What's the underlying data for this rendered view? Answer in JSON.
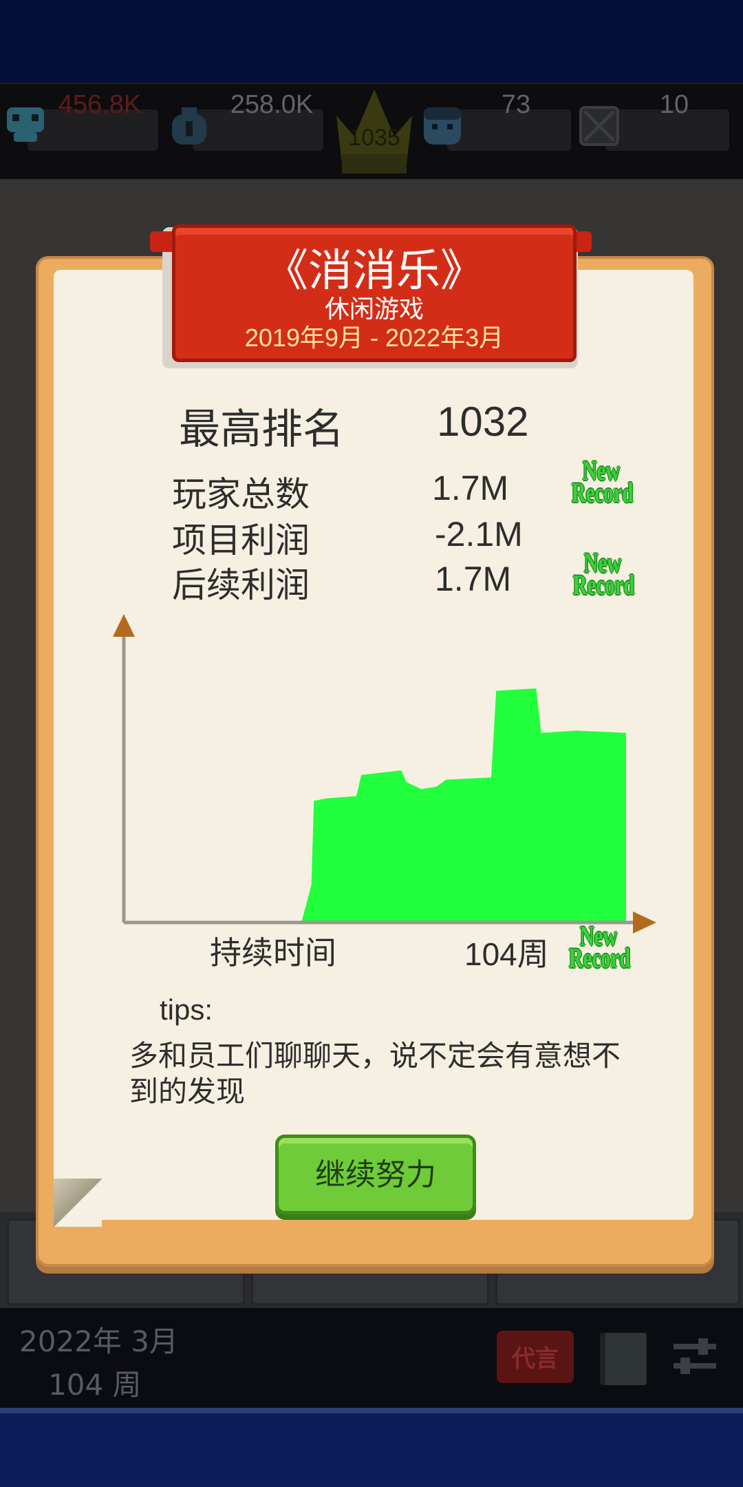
{
  "stats_bar": {
    "money": "456.8K",
    "fans": "258.0K",
    "rank": "1035",
    "employees": "73",
    "extra": "10"
  },
  "modal": {
    "game_title": "《消消乐》",
    "game_genre": "休闲游戏",
    "game_period": "2019年9月 - 2022年3月",
    "best_rank_label": "最高排名",
    "best_rank_value": "1032",
    "rows": [
      {
        "label": "玩家总数",
        "value": "1.7M",
        "new_record": true
      },
      {
        "label": "项目利润",
        "value": "-2.1M",
        "new_record": false
      },
      {
        "label": "后续利润",
        "value": "1.7M",
        "new_record": true
      }
    ],
    "new_record_text": "New Record",
    "duration_label": "持续时间",
    "duration_value": "104周",
    "duration_new_record": true,
    "tips_title": "tips:",
    "tips_text": "多和员工们聊聊天，说不定会有意想不到的发现",
    "continue_label": "继续努力"
  },
  "chart_data": {
    "type": "area",
    "series": [
      {
        "values": [
          0,
          0,
          0,
          0,
          0,
          0,
          0,
          0,
          0,
          0,
          0,
          0,
          0,
          0,
          0,
          0,
          0,
          0,
          0,
          0,
          0,
          0,
          0,
          0,
          0,
          0,
          0,
          0,
          0,
          0,
          0,
          0,
          0,
          0,
          0,
          0,
          0,
          0,
          0,
          0,
          0,
          0,
          0,
          0,
          0,
          0,
          0,
          0,
          0,
          0,
          0,
          0,
          0,
          0,
          0,
          0,
          0,
          0,
          0,
          0,
          0,
          0,
          0,
          0,
          0,
          0,
          0,
          0,
          0,
          0,
          0,
          0,
          0,
          0,
          0,
          0,
          0,
          0,
          0,
          0,
          0,
          0,
          0,
          0,
          0,
          0,
          0,
          0,
          0,
          0,
          0,
          0,
          0,
          0,
          0,
          0,
          0,
          0,
          0,
          0,
          0,
          0,
          0,
          0
        ]
      }
    ],
    "profile": [
      [
        0.0,
        0.0
      ],
      [
        0.35,
        0.0
      ],
      [
        0.36,
        0.08
      ],
      [
        0.37,
        0.16
      ],
      [
        0.375,
        0.52
      ],
      [
        0.4,
        0.53
      ],
      [
        0.46,
        0.54
      ],
      [
        0.47,
        0.63
      ],
      [
        0.55,
        0.65
      ],
      [
        0.56,
        0.6
      ],
      [
        0.59,
        0.57
      ],
      [
        0.62,
        0.58
      ],
      [
        0.64,
        0.61
      ],
      [
        0.73,
        0.62
      ],
      [
        0.74,
        0.99
      ],
      [
        0.82,
        1.0
      ],
      [
        0.83,
        0.81
      ],
      [
        0.9,
        0.82
      ],
      [
        1.0,
        0.81
      ]
    ],
    "xlabel": "持续时间",
    "xlim": [
      0,
      104
    ],
    "grid": false,
    "color": "#22ff3c",
    "axis_color": "#9a9690",
    "arrow_color": "#b36a1c"
  }
}
